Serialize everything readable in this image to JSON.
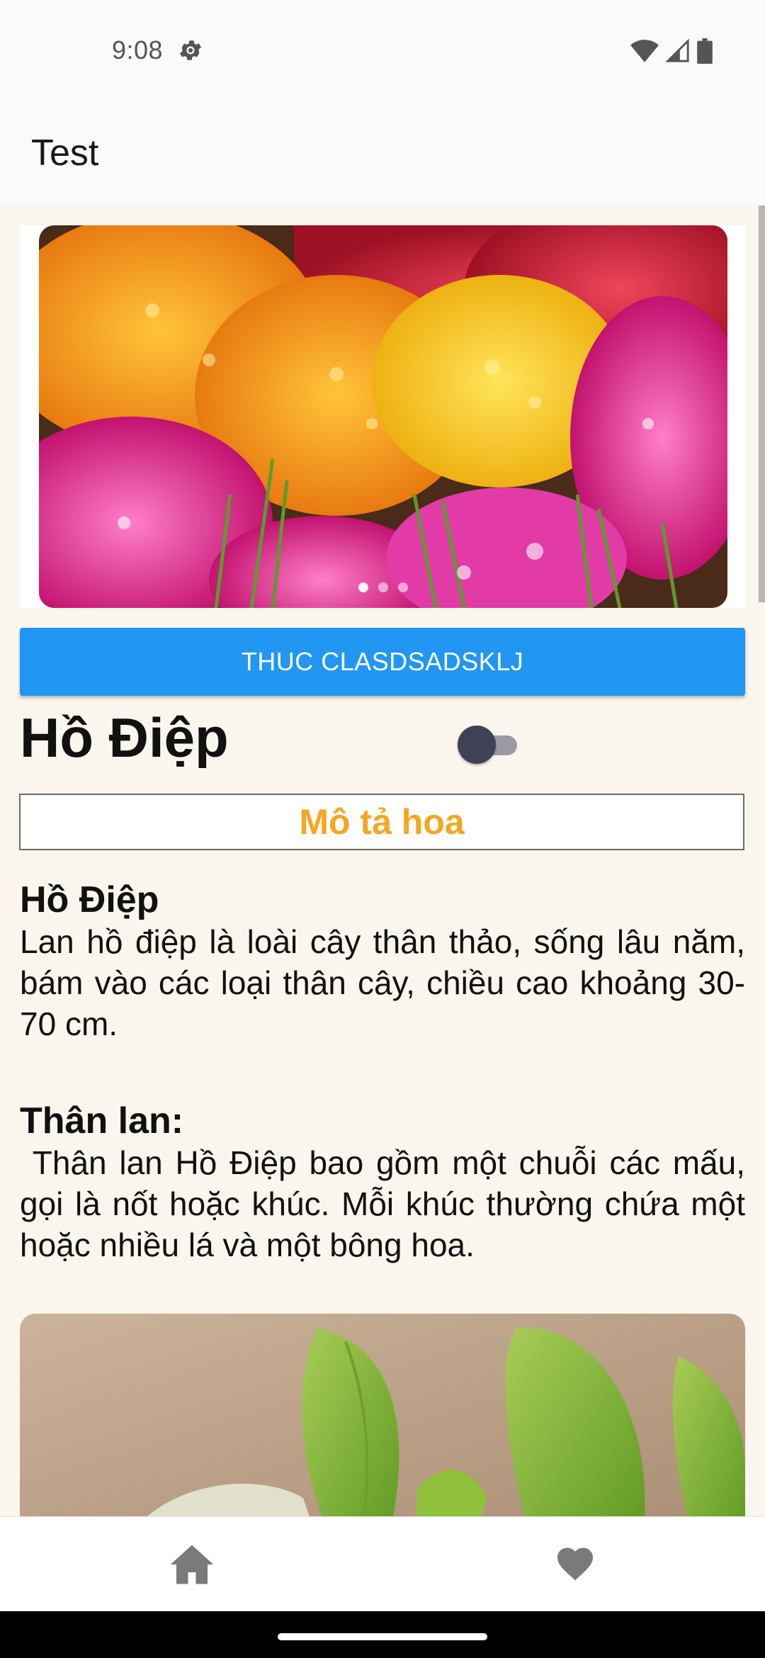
{
  "status_bar": {
    "time": "9:08",
    "icons": [
      "settings-gear-icon",
      "wifi-icon",
      "cellular-signal-icon",
      "battery-icon"
    ]
  },
  "app_bar": {
    "title": "Test"
  },
  "carousel": {
    "image_description": "orchid-bouquet-image",
    "dot_count": 3,
    "active_dot": 1
  },
  "primary_button": {
    "label": "THUC CLASDSADSKLJ",
    "color": "#2196f3"
  },
  "flower": {
    "name": "Hồ Điệp",
    "favorite_toggle_on": false
  },
  "description_header": {
    "label": "Mô tả hoa",
    "color": "#f5a623"
  },
  "sections": [
    {
      "title": "Hồ Điệp",
      "body": "Lan hồ điệp là loài cây thân thảo, sống lâu năm, bám vào các loại thân cây, chiều cao khoảng 30-70 cm."
    },
    {
      "title": "Thân lan:",
      "body": " Thân lan Hồ Điệp bao gồm một chuỗi các mấu, gọi là nốt hoặc khúc. Mỗi khúc thường chứa một hoặc nhiều lá và một bông hoa."
    }
  ],
  "bottom_nav": {
    "items": [
      "home-icon",
      "heart-icon"
    ]
  }
}
